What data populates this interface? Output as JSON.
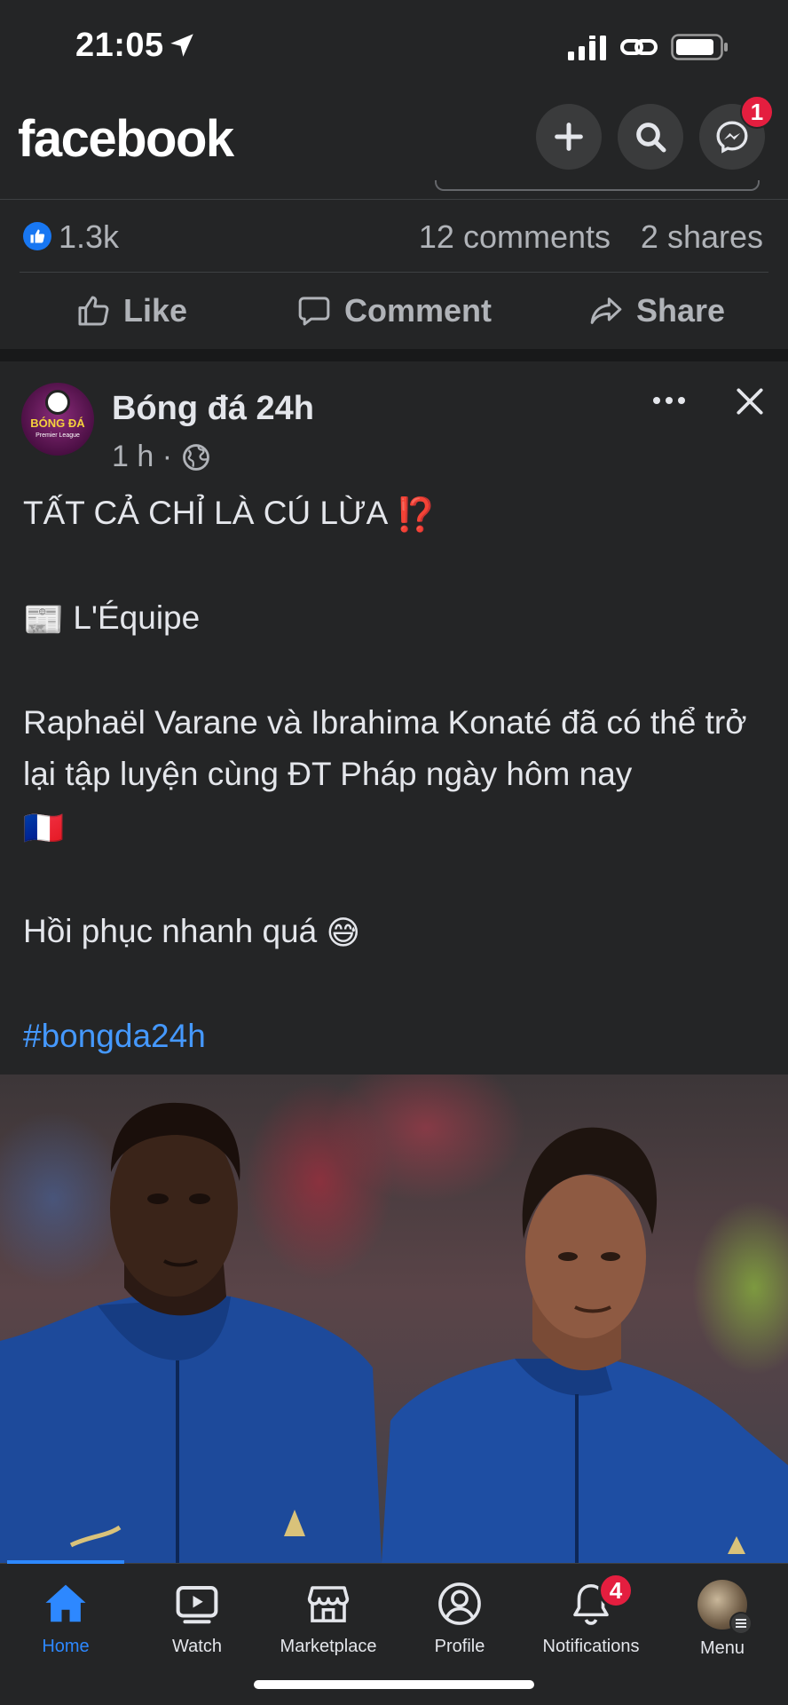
{
  "status_bar": {
    "time": "21:05"
  },
  "header": {
    "logo": "facebook",
    "messenger_badge": "1"
  },
  "post_stats": {
    "reaction_count": "1.3k",
    "comments": "12 comments",
    "shares": "2 shares"
  },
  "actions": {
    "like": "Like",
    "comment": "Comment",
    "share": "Share"
  },
  "post": {
    "page_name": "Bóng đá 24h",
    "avatar_text": "BÓNG ĐÁ",
    "avatar_sub": "Premier League",
    "time": "1 h ·",
    "line1": "TẤT CẢ CHỈ LÀ CÚ LỪA",
    "line1_emoji": "⁉️",
    "source_emoji": "📰",
    "source": "L'Équipe",
    "line3": "Raphaël Varane và Ibrahima Konaté đã có thể trở lại tập luyện cùng ĐT Pháp ngày hôm nay",
    "line3_emoji": "🇫🇷",
    "line4": "Hồi phục nhanh quá",
    "line4_emoji": "😅",
    "hashtag": "#bongda24h"
  },
  "bottom_nav": {
    "home": "Home",
    "watch": "Watch",
    "marketplace": "Marketplace",
    "profile": "Profile",
    "notifications": "Notifications",
    "notifications_badge": "4",
    "menu": "Menu",
    "active_tab": "Home"
  },
  "colors": {
    "background": "#242526",
    "accent": "#2d88ff",
    "badge": "#e41e3f",
    "hashtag": "#4599ff"
  }
}
